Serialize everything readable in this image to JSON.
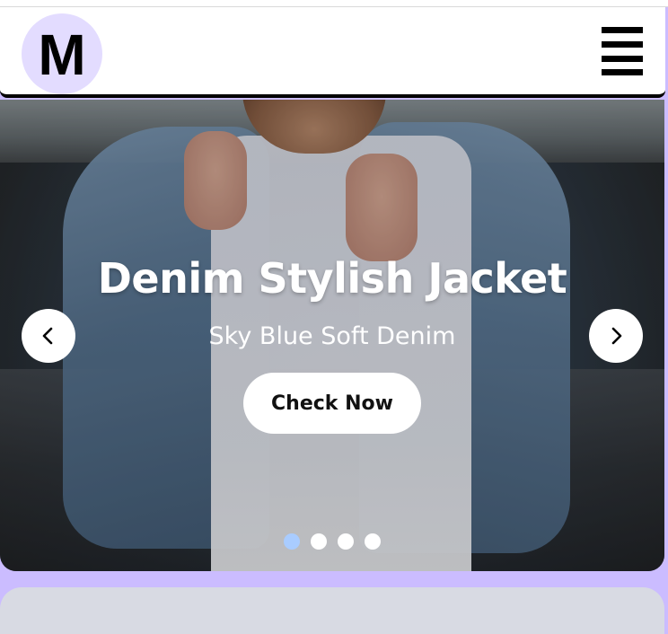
{
  "header": {
    "logo_letter": "M",
    "menu_icon": "hamburger-menu-icon"
  },
  "hero": {
    "title": "Denim Stylish Jacket",
    "subtitle": "Sky Blue Soft Denim",
    "cta_label": "Check Now",
    "prev_icon": "chevron-left-icon",
    "next_icon": "chevron-right-icon",
    "slide_count": 4,
    "active_slide": 1
  },
  "colors": {
    "page_background": "#cbbcff",
    "logo_background": "#e3dcff",
    "active_dot": "#a9ccff",
    "inactive_dot": "#ffffff",
    "card_background": "#d8dae3"
  }
}
